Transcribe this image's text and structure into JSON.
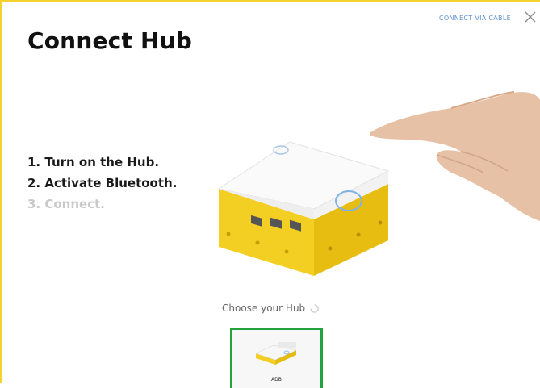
{
  "dialog": {
    "title": "Connect Hub",
    "cable_link": "CONNECT VIA CABLE"
  },
  "steps": [
    "1. Turn on the Hub.",
    "2. Activate Bluetooth.",
    "3. Connect."
  ],
  "chooser": {
    "label": "Choose your Hub",
    "hubs": [
      {
        "name": "ADB"
      }
    ]
  },
  "icons": {
    "close": "close-icon",
    "loading": "spinner-icon"
  },
  "colors": {
    "accent_border": "#f3d230",
    "selected_border": "#23a33d",
    "link": "#5d8fd0"
  }
}
